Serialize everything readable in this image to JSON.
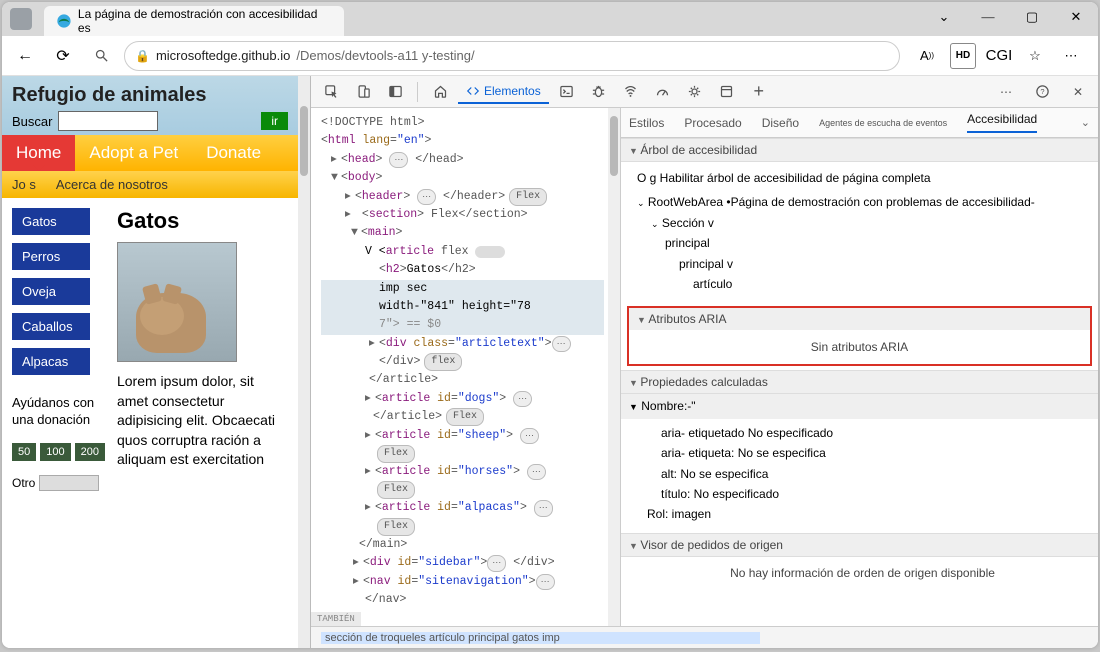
{
  "window": {
    "tab_title": "La página de demostración con accesibilidad es",
    "controls": [
      "⌄",
      "—",
      "▢",
      "✕"
    ]
  },
  "addr": {
    "url_host": "microsoftedge.github.io",
    "url_path": "/Demos/devtools-a11 y-testing/",
    "right_label": "CGI"
  },
  "page": {
    "title": "Refugio de animales",
    "search_label": "Buscar",
    "go_label": "ir",
    "nav": [
      "Home",
      "Adopt a Pet",
      "Donate"
    ],
    "subnav": [
      "Jo s",
      "Acerca de nosotros"
    ],
    "side_items": [
      "Gatos",
      "Perros",
      "Oveja",
      "Caballos",
      "Alpacas"
    ],
    "donate_label": "Ayúdanos con una donación",
    "donate_amounts": [
      "50",
      "100",
      "200"
    ],
    "otro_label": "Otro",
    "article_heading": "Gatos",
    "lorem": "Lorem ipsum dolor, sit amet consectetur adipisicing elit. Obcaecati quos corruptra ración a aliquam est exercitation"
  },
  "devtools": {
    "main_tab": "Elementos",
    "also": "TAMBIÉN",
    "tree": {
      "doctype": "<!DOCTYPE html>",
      "html_open": "html",
      "html_lang": "lang",
      "html_lang_v": "\"en\"",
      "head": "head",
      "head_close": "</head>",
      "body": "body",
      "header": "header",
      "header_close": "</header>",
      "section": "section",
      "section_txt": "Flex",
      "section_close": "</section>",
      "main": "main",
      "article": "article",
      "article_open_txt": "flex",
      "h2": "h2",
      "h2_txt": "Gatos",
      "h2_close": "</h2>",
      "impsec": "imp sec",
      "dims": "width-\"841\" height=\"78",
      "dims2": "7\"> == $0",
      "div": "div",
      "div_class": "class",
      "div_class_v": "\"articletext\"",
      "div_close": "</div>",
      "article_close": "</article>",
      "dogs_attr": "id",
      "dogs_v": "\"dogs\"",
      "sheep_v": "\"sheep\"",
      "horses_v": "\"horses\"",
      "alpacas_v": "\"alpacas\"",
      "main_close": "</main>",
      "sidebar_v": "\"sidebar\"",
      "nav_tag": "nav",
      "nav_v": "\"sitenavigation\"",
      "nav_close2": "</nav>",
      "flex_badge": "Flex",
      "flex_badge_lc": "flex"
    },
    "breadcrumb": "sección de troqueles artículo principal gatos imp",
    "side_tabs": [
      "Estilos",
      "Procesado",
      "Diseño",
      "Agentes de escucha de eventos",
      "Accesibilidad"
    ],
    "a11y": {
      "tree_hdr": "Árbol de accesibilidad",
      "enable": "O g Habilitar árbol de accesibilidad de página completa",
      "root": "RootWebArea •Página de demostración con problemas de accesibilidad-",
      "seccion": "Sección v",
      "principal": "principal",
      "principal_v": "principal v",
      "articulo": "artículo",
      "aria_hdr": "Atributos ARIA",
      "aria_empty": "Sin atributos ARIA",
      "computed_hdr": "Propiedades calculadas",
      "nombre": "Nombre:-\"",
      "c1": "aria- etiquetado No especificado",
      "c2": "aria- etiqueta: No se especifica",
      "c3": "alt: No se especifica",
      "c4": "título: No especificado",
      "rol": "Rol: imagen",
      "source_hdr": "Visor de pedidos de origen",
      "source_empty": "No hay información de orden de origen disponible"
    }
  }
}
